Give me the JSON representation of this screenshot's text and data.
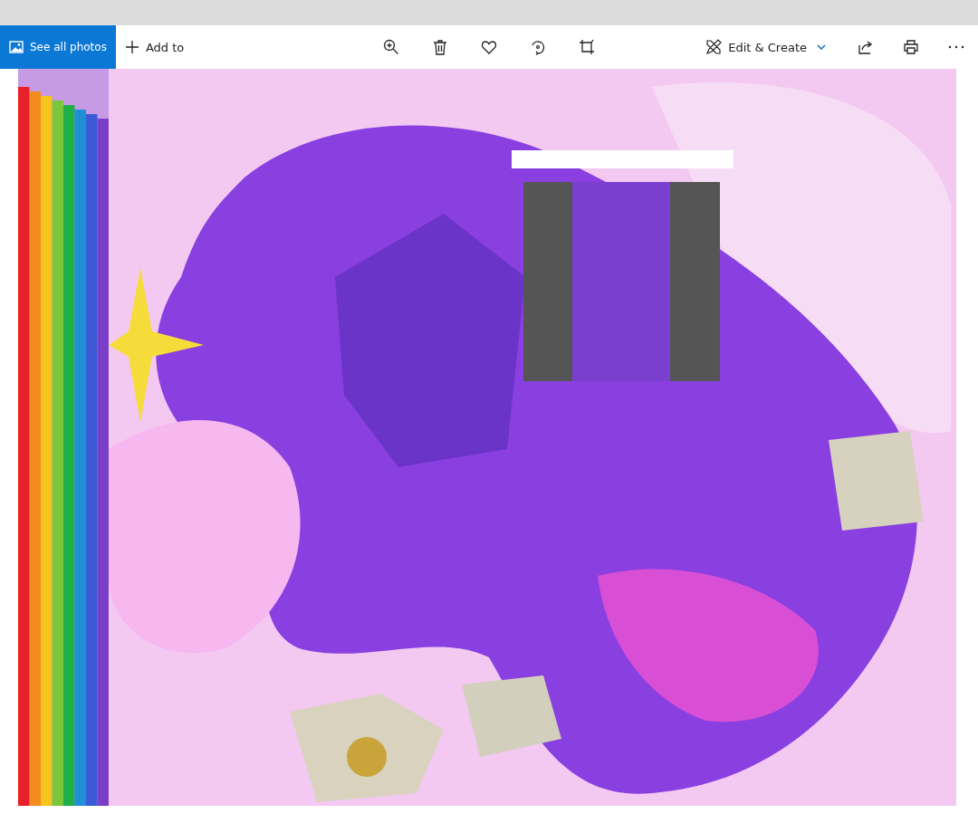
{
  "toolbar": {
    "see_all_photos": {
      "label": "See all photos"
    },
    "add_to": {
      "label": "Add to"
    },
    "edit_create": {
      "label": "Edit & Create"
    }
  }
}
